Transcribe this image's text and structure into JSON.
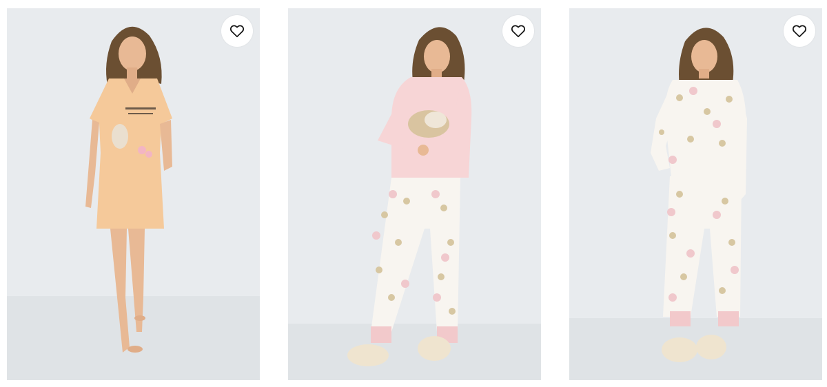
{
  "products": [
    {
      "id_label": "product-1",
      "image_alt": "",
      "wishlist_icon": "heart-outline-icon"
    },
    {
      "id_label": "product-2",
      "image_alt": "",
      "wishlist_icon": "heart-outline-icon"
    },
    {
      "id_label": "product-3",
      "image_alt": "",
      "wishlist_icon": "heart-outline-icon"
    }
  ],
  "colors": {
    "background": "#ffffff",
    "photo_backdrop": "#e9ecef",
    "floor": "#dfe3e6",
    "nightdress": "#f5c99a",
    "pink_top": "#f7d5d6",
    "pajama_print": "#f8f5f0",
    "slipper": "#efe4cf",
    "heart_icon": "#111111"
  }
}
